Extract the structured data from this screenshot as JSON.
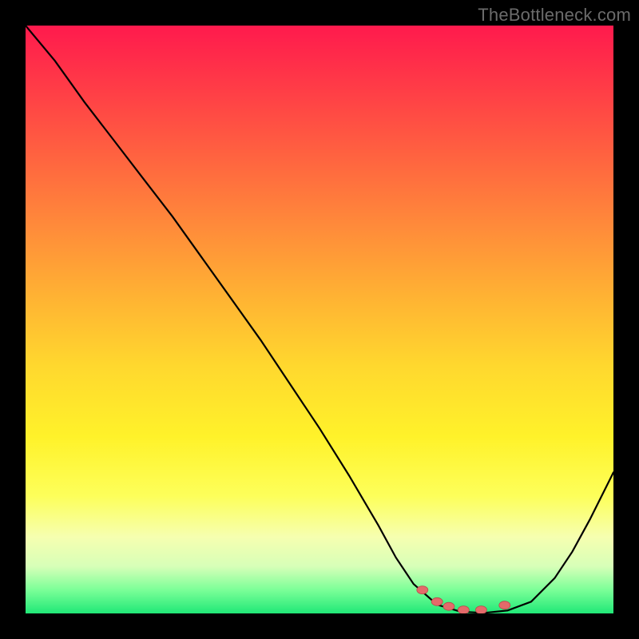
{
  "watermark": "TheBottleneck.com",
  "colors": {
    "frame": "#000000",
    "gradient_top": "#ff1a4d",
    "gradient_bottom": "#20e877",
    "curve_stroke": "#000000",
    "marker_fill": "#e46a6a",
    "marker_stroke": "#b84a4a"
  },
  "chart_data": {
    "type": "line",
    "title": "",
    "xlabel": "",
    "ylabel": "",
    "xlim": [
      0,
      100
    ],
    "ylim": [
      0,
      100
    ],
    "grid": false,
    "legend": false,
    "series": [
      {
        "name": "curve",
        "x": [
          0,
          5,
          10,
          15,
          20,
          25,
          30,
          35,
          40,
          45,
          50,
          55,
          60,
          63,
          66,
          70,
          74,
          78,
          82,
          86,
          90,
          93,
          96,
          100
        ],
        "y": [
          100,
          94,
          87,
          80.5,
          74,
          67.5,
          60.5,
          53.5,
          46.5,
          39,
          31.5,
          23.5,
          15,
          9.5,
          5,
          1.5,
          0.3,
          0.1,
          0.5,
          2,
          6,
          10.5,
          16,
          24
        ]
      }
    ],
    "markers": {
      "comment": "highlighted points near trough",
      "x": [
        67.5,
        70,
        72,
        74.5,
        77.5,
        81.5
      ],
      "y": [
        4,
        2,
        1.2,
        0.6,
        0.6,
        1.4
      ]
    }
  }
}
